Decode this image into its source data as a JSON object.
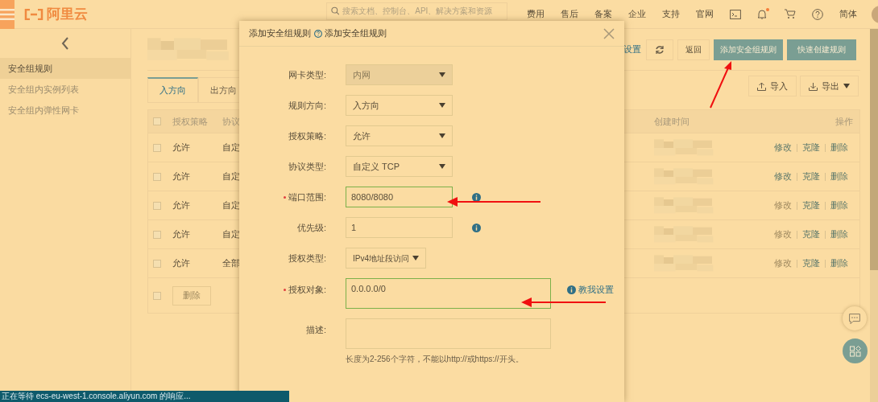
{
  "topbar": {
    "logo": "阿里云",
    "search": {
      "placeholder": "搜索文档、控制台、API、解决方案和资源"
    },
    "nav": [
      "费用",
      "售后",
      "备案",
      "企业",
      "支持",
      "官网"
    ],
    "has_notification": true,
    "language": "简体"
  },
  "sidebar": {
    "items": [
      {
        "label": "安全组规则",
        "selected": true
      },
      {
        "label": "安全组内实例列表",
        "selected": false
      },
      {
        "label": "安全组内弹性网卡",
        "selected": false
      }
    ]
  },
  "toolbar": {
    "link": "设置",
    "buttons": [
      {
        "label": "返回",
        "kind": "plain"
      },
      {
        "label": "添加安全组规则",
        "kind": "primary"
      },
      {
        "label": "快速创建规则",
        "kind": "primary"
      }
    ]
  },
  "tabs": [
    {
      "label": "入方向",
      "selected": true
    },
    {
      "label": "出方向",
      "selected": false
    }
  ],
  "actions": [
    "导入",
    "导出"
  ],
  "table": {
    "header_checked": false,
    "footer_checked": false,
    "columns": [
      "授权策略",
      "协议",
      "创建时间",
      "操作"
    ],
    "rows": [
      {
        "checked": false,
        "policy": "允许",
        "protocol": "自定",
        "actions": [
          {
            "label": "修改",
            "disabled": false
          },
          {
            "label": "克隆",
            "disabled": false
          },
          {
            "label": "删除",
            "disabled": false
          }
        ]
      },
      {
        "checked": false,
        "policy": "允许",
        "protocol": "自定",
        "actions": [
          {
            "label": "修改",
            "disabled": false
          },
          {
            "label": "克隆",
            "disabled": false
          },
          {
            "label": "删除",
            "disabled": false
          }
        ]
      },
      {
        "checked": false,
        "policy": "允许",
        "protocol": "自定",
        "actions": [
          {
            "label": "修改",
            "disabled": true
          },
          {
            "label": "克隆",
            "disabled": false
          },
          {
            "label": "删除",
            "disabled": false
          }
        ]
      },
      {
        "checked": false,
        "policy": "允许",
        "protocol": "自定",
        "actions": [
          {
            "label": "修改",
            "disabled": true
          },
          {
            "label": "克隆",
            "disabled": false
          },
          {
            "label": "删除",
            "disabled": false
          }
        ]
      },
      {
        "checked": false,
        "policy": "允许",
        "protocol": "全部",
        "actions": [
          {
            "label": "修改",
            "disabled": true
          },
          {
            "label": "克隆",
            "disabled": false
          },
          {
            "label": "删除",
            "disabled": false
          }
        ]
      }
    ],
    "delete_button": "删除"
  },
  "dialog": {
    "title": "添加安全组规则",
    "help": "添加安全组规则",
    "fields": [
      {
        "label": "网卡类型:",
        "kind": "select",
        "value": "内网",
        "disabled": true,
        "required": false,
        "valid": false
      },
      {
        "label": "规则方向:",
        "kind": "select",
        "value": "入方向",
        "disabled": false,
        "required": false,
        "valid": false
      },
      {
        "label": "授权策略:",
        "kind": "select",
        "value": "允许",
        "disabled": false,
        "required": false,
        "valid": false
      },
      {
        "label": "协议类型:",
        "kind": "select",
        "value": "自定义 TCP",
        "disabled": false,
        "required": false,
        "valid": false
      },
      {
        "label": "端口范围:",
        "kind": "input",
        "value": "8080/8080",
        "disabled": false,
        "required": true,
        "valid": true,
        "info": true
      },
      {
        "label": "优先级:",
        "kind": "input",
        "value": "1",
        "disabled": false,
        "required": false,
        "valid": false,
        "info": true
      },
      {
        "label": "授权类型:",
        "kind": "select_small",
        "value": "IPv4地址段访问",
        "disabled": false,
        "required": false,
        "valid": false
      },
      {
        "label": "授权对象:",
        "kind": "textarea",
        "value": "0.0.0.0/0",
        "disabled": false,
        "required": true,
        "valid": true,
        "link": "教我设置"
      },
      {
        "label": "描述:",
        "kind": "textarea",
        "disabled": false,
        "required": false,
        "valid": false,
        "hint": "长度为2-256个字符，不能以http://或https://开头。"
      }
    ]
  },
  "status_bar": "正在等待 ecs-eu-west-1.console.aliyun.com 的响应..."
}
